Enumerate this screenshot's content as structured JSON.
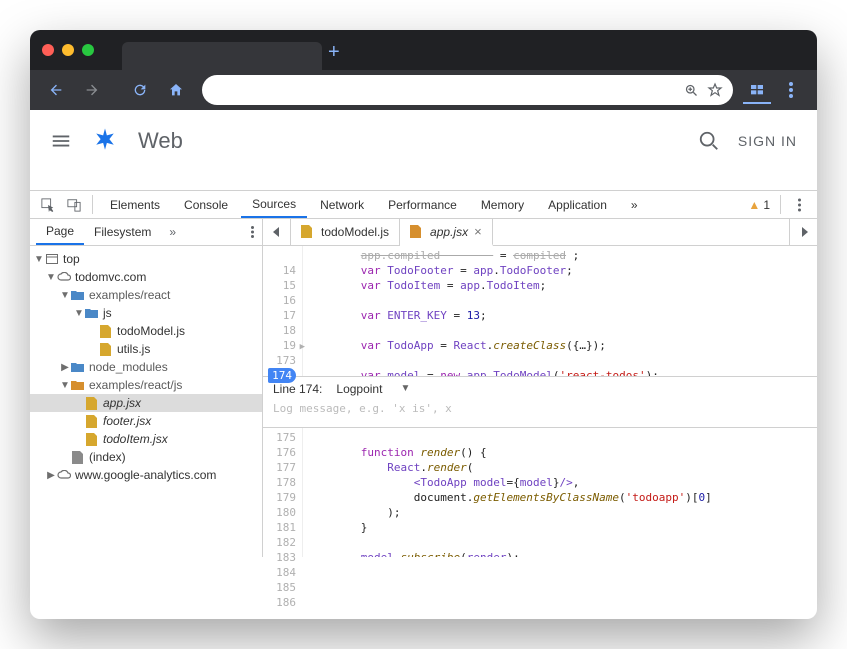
{
  "browser": {
    "new_tab_glyph": "+",
    "nav": {
      "back": "←",
      "forward": "→",
      "reload": "⟳",
      "home": "⌂"
    },
    "omnibox": {
      "zoom_icon": "⊕",
      "star": "☆"
    },
    "menu_glyph": "⋮"
  },
  "app_header": {
    "title": "Web",
    "signin": "SIGN IN"
  },
  "devtools": {
    "tabs": [
      "Elements",
      "Console",
      "Sources",
      "Network",
      "Performance",
      "Memory",
      "Application"
    ],
    "active_tab": "Sources",
    "overflow_glyph": "»",
    "warning_count": "1",
    "nav_tabs": [
      "Page",
      "Filesystem"
    ],
    "nav_active": "Page",
    "tree": {
      "top": "top",
      "domain": "todomvc.com",
      "folder1": "examples/react",
      "folder_js": "js",
      "file_model": "todoModel.js",
      "file_utils": "utils.js",
      "node_modules": "node_modules",
      "folder2": "examples/react/js",
      "file_app": "app.jsx",
      "file_footer": "footer.jsx",
      "file_todoitem": "todoItem.jsx",
      "index": "(index)",
      "ga": "www.google-analytics.com"
    },
    "editor_tabs": {
      "t1": "todoModel.js",
      "t2": "app.jsx"
    },
    "gutter_before": [
      "",
      "14",
      "15",
      "16",
      "17",
      "18",
      "19",
      "173",
      "174"
    ],
    "gutter_after": [
      "175",
      "176",
      "177",
      "178",
      "179",
      "180",
      "181",
      "182",
      "183",
      "184",
      "185",
      "186"
    ],
    "logpoint": {
      "line_label": "Line 174:",
      "type": "Logpoint",
      "placeholder": "Log message, e.g. 'x is', x"
    }
  }
}
